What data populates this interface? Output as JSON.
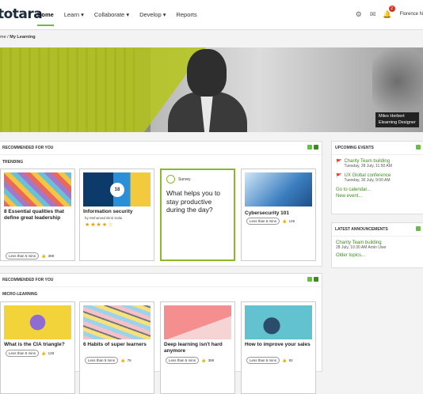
{
  "header": {
    "logo": "totara",
    "nav": [
      "Home",
      "Learn ▾",
      "Collaborate ▾",
      "Develop ▾",
      "Reports"
    ],
    "username": "Florence N",
    "notification_count": "2"
  },
  "breadcrumb": {
    "home": "me",
    "current": "My Learning"
  },
  "hero": {
    "caption_name": "Miles Herbert",
    "caption_role": "Elearning Designer"
  },
  "recommended1": {
    "heading": "RECOMMENDED FOR YOU",
    "subheading": "TRENDING",
    "cards": [
      {
        "title": "8 Essential qualities that define great leadership",
        "duration": "Less than 5 mins",
        "likes": "388"
      },
      {
        "title": "Information security",
        "by": "by Mohamad Binti Salai",
        "badge": "18",
        "stars": "★★★★☆"
      },
      {
        "survey_label": "Survey",
        "question": "What helps you to stay productive during the day?"
      },
      {
        "title": "Cybersecurity 101",
        "duration": "Less than 5 mins",
        "likes": "145"
      }
    ]
  },
  "recommended2": {
    "heading": "RECOMMENDED FOR YOU",
    "subheading": "MICRO-LEARNING",
    "cards": [
      {
        "title": "What is the CIA triangle?",
        "duration": "Less than 5 mins",
        "likes": "128"
      },
      {
        "title": "6 Habits of super learners",
        "duration": "Less than 5 mins",
        "likes": "76"
      },
      {
        "title": "Deep learning isn't hard anymore",
        "duration": "Less than 5 mins",
        "likes": "388"
      },
      {
        "title": "How to improve your sales",
        "duration": "Less than 5 mins",
        "likes": "92"
      }
    ]
  },
  "upcoming": {
    "heading": "UPCOMING EVENTS",
    "events": [
      {
        "title": "Charity Team building",
        "date": "Tuesday, 28 July, 11:50 AM"
      },
      {
        "title": "UX Global conference",
        "date": "Tuesday, 30 July, 9:00 AM"
      }
    ],
    "calendar_link": "Go to calendar...",
    "new_event": "New event..."
  },
  "announcements": {
    "heading": "LATEST ANNOUNCEMENTS",
    "title": "Charity Team building",
    "meta": "28 July, 10:30 AM Amin User",
    "older": "Older topics..."
  }
}
